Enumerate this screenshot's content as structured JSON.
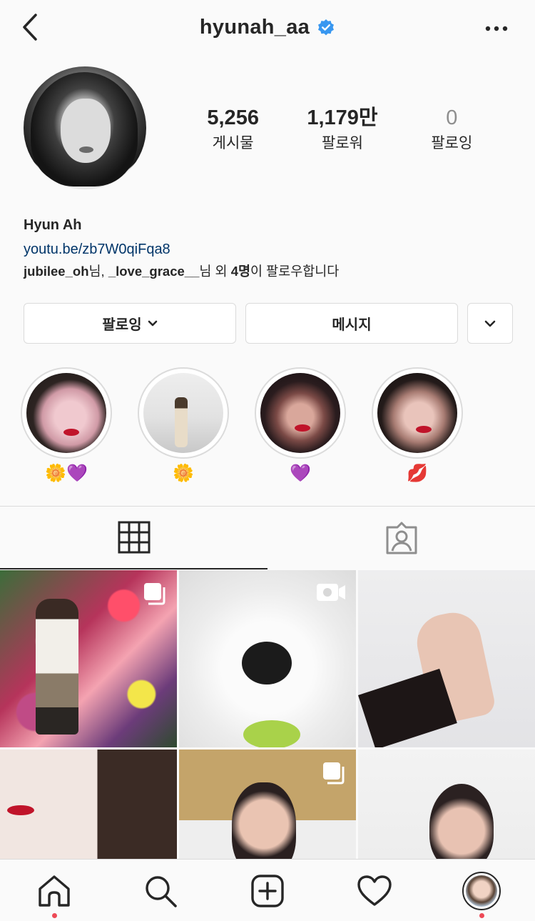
{
  "header": {
    "username": "hyunah_aa",
    "verified": true
  },
  "stats": {
    "posts": {
      "value": "5,256",
      "label": "게시물"
    },
    "followers": {
      "value": "1,179만",
      "label": "팔로워"
    },
    "following": {
      "value": "0",
      "label": "팔로잉"
    }
  },
  "bio": {
    "name": "Hyun Ah",
    "link": "youtu.be/zb7W0qiFqa8",
    "followed_by": {
      "user1": "jubilee_oh",
      "sep1": "님, ",
      "user2": "_love_grace__",
      "mid": "님 외 ",
      "count": "4명",
      "tail": "이 팔로우합니다"
    }
  },
  "buttons": {
    "following": "팔로잉",
    "message": "메시지"
  },
  "highlights": [
    {
      "label": "🌼💜"
    },
    {
      "label": "🌼"
    },
    {
      "label": "💜"
    },
    {
      "label": "💋"
    }
  ],
  "colors": {
    "link": "#003569",
    "accent_dot": "#ed4956",
    "border": "#dbdbdb",
    "verified": "#3897f0"
  },
  "icons": {
    "back": "chevron-left-icon",
    "more": "more-dots-icon",
    "grid": "grid-icon",
    "tagged": "tagged-user-icon",
    "multi": "multiple-posts-icon",
    "video": "video-camera-icon",
    "home": "home-icon",
    "search": "search-icon",
    "add": "add-post-icon",
    "activity": "heart-icon",
    "profile": "profile-avatar"
  }
}
